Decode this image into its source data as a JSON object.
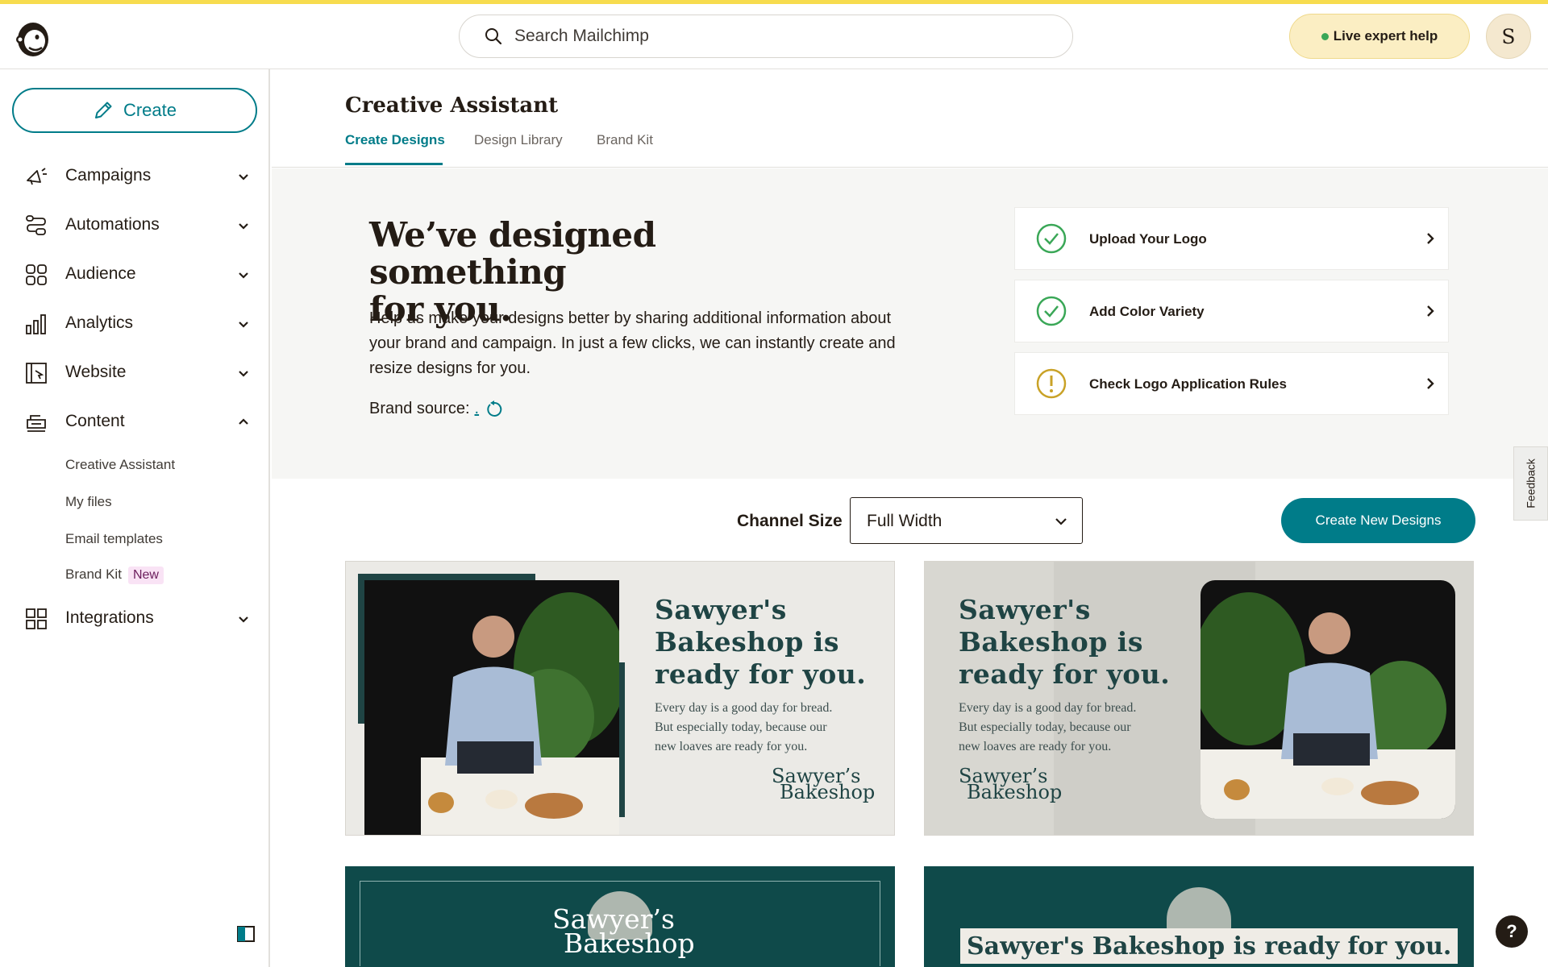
{
  "header": {
    "search_placeholder": "Search Mailchimp",
    "help_label": "Live expert help",
    "avatar_initial": "S"
  },
  "sidebar": {
    "create_label": "Create",
    "items": [
      {
        "label": "Campaigns",
        "icon": "megaphone-icon"
      },
      {
        "label": "Automations",
        "icon": "automations-icon"
      },
      {
        "label": "Audience",
        "icon": "audience-icon"
      },
      {
        "label": "Analytics",
        "icon": "bar-chart-icon"
      },
      {
        "label": "Website",
        "icon": "website-icon"
      },
      {
        "label": "Content",
        "icon": "content-icon"
      },
      {
        "label": "Integrations",
        "icon": "grid-icon"
      }
    ],
    "content_subitems": [
      "Creative Assistant",
      "My files",
      "Email templates",
      "Brand Kit"
    ],
    "new_badge": "New"
  },
  "page": {
    "title": "Creative Assistant",
    "tabs": [
      "Create Designs",
      "Design Library",
      "Brand Kit"
    ],
    "active_tab": "Create Designs"
  },
  "hero": {
    "title_line1": "We’ve designed something",
    "title_line2": "for you.",
    "description": "Help us make your designs better by sharing additional information about your brand and campaign. In just a few clicks, we can instantly create and resize designs for you.",
    "brand_source_label": "Brand source:",
    "brand_source_value": "."
  },
  "tasks": [
    {
      "label": "Upload Your Logo",
      "status": "complete"
    },
    {
      "label": "Add Color Variety",
      "status": "complete"
    },
    {
      "label": "Check Logo Application Rules",
      "status": "warning"
    }
  ],
  "controls": {
    "channel_size_label": "Channel Size",
    "channel_size_value": "Full Width",
    "create_new_label": "Create New Designs"
  },
  "designs": {
    "headline_l1": "Sawyer's",
    "headline_l2": "Bakeshop is",
    "headline_l3": "ready for you.",
    "body_l1": "Every day is a good day for bread.",
    "body_l2": "But especially today, because our",
    "body_l3": "new loaves are ready for you.",
    "sig_l1": "Sawyer’s",
    "sig_l2": "Bakeshop",
    "banner_text": "Sawyer's Bakeshop is ready for you."
  },
  "feedback_label": "Feedback",
  "help_button": "?",
  "colors": {
    "brand_teal": "#007c89",
    "top_accent": "#f7dc4e",
    "success_green": "#3aa757",
    "warning_gold": "#c9a227",
    "card_dark": "#0f4a4a"
  }
}
